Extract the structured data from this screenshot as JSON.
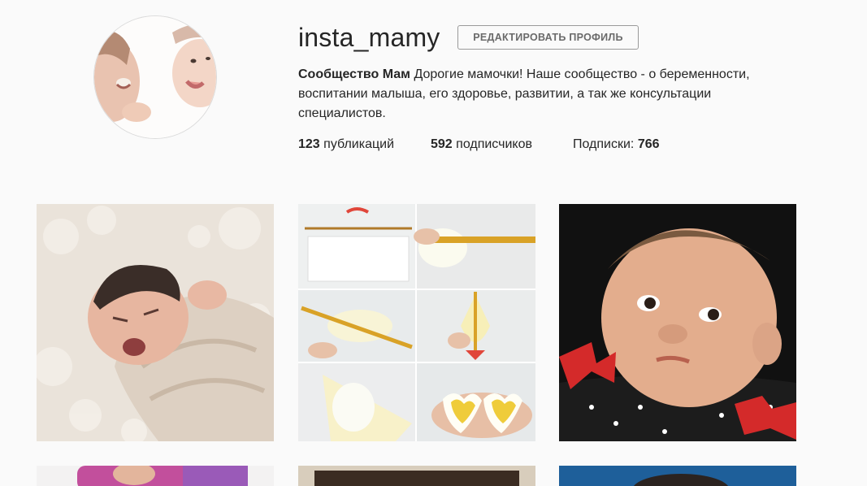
{
  "profile": {
    "username": "insta_mamy",
    "edit_profile_label": "РЕДАКТИРОВАТЬ ПРОФИЛЬ",
    "full_name": "Сообщество Мам",
    "bio": "Дорогие мамочки! Наше сообщество - о беременности, воспитании малыша, его здоровье, развитии, а так же консультации специалистов.",
    "avatar_icon": "mother-and-baby-photo"
  },
  "stats": {
    "posts_count": "123",
    "posts_label": "публикаций",
    "followers_count": "592",
    "followers_label": "подписчиков",
    "following_label": "Подписки:",
    "following_count": "766"
  },
  "posts": [
    {
      "subject": "newborn-yawning-photo"
    },
    {
      "subject": "heart-shaped-egg-tutorial-photo"
    },
    {
      "subject": "baby-with-red-bow-photo"
    },
    {
      "subject": "pink-bottle-photo"
    },
    {
      "subject": "brown-photo"
    },
    {
      "subject": "baby-blue-background-photo"
    }
  ],
  "colors": {
    "background": "#fafafa",
    "text": "#262626",
    "button_border": "#9a9a9a",
    "button_text": "#6a6a6a"
  }
}
